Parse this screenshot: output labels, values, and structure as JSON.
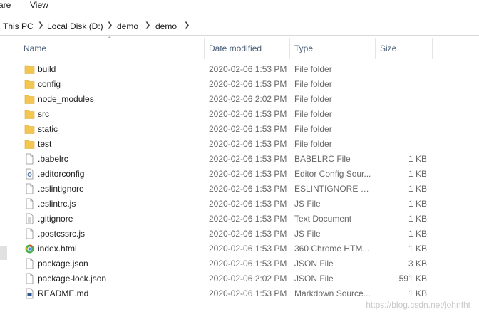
{
  "ribbon": {
    "share": "are",
    "view": "View"
  },
  "breadcrumb": [
    "This PC",
    "Local Disk (D:)",
    "demo",
    "demo"
  ],
  "columns": {
    "name": "Name",
    "date": "Date modified",
    "type": "Type",
    "size": "Size"
  },
  "files": [
    {
      "name": "build",
      "date": "2020-02-06 1:53 PM",
      "type": "File folder",
      "size": "",
      "icon": "folder-icon"
    },
    {
      "name": "config",
      "date": "2020-02-06 1:53 PM",
      "type": "File folder",
      "size": "",
      "icon": "folder-icon"
    },
    {
      "name": "node_modules",
      "date": "2020-02-06 2:02 PM",
      "type": "File folder",
      "size": "",
      "icon": "folder-icon"
    },
    {
      "name": "src",
      "date": "2020-02-06 1:53 PM",
      "type": "File folder",
      "size": "",
      "icon": "folder-icon"
    },
    {
      "name": "static",
      "date": "2020-02-06 1:53 PM",
      "type": "File folder",
      "size": "",
      "icon": "folder-icon"
    },
    {
      "name": "test",
      "date": "2020-02-06 1:53 PM",
      "type": "File folder",
      "size": "",
      "icon": "folder-icon"
    },
    {
      "name": ".babelrc",
      "date": "2020-02-06 1:53 PM",
      "type": "BABELRC File",
      "size": "1 KB",
      "icon": "file-icon"
    },
    {
      "name": ".editorconfig",
      "date": "2020-02-06 1:53 PM",
      "type": "Editor Config Sour...",
      "size": "1 KB",
      "icon": "settings-file-icon"
    },
    {
      "name": ".eslintignore",
      "date": "2020-02-06 1:53 PM",
      "type": "ESLINTIGNORE File",
      "size": "1 KB",
      "icon": "file-icon"
    },
    {
      "name": ".eslintrc.js",
      "date": "2020-02-06 1:53 PM",
      "type": "JS File",
      "size": "1 KB",
      "icon": "file-icon"
    },
    {
      "name": ".gitignore",
      "date": "2020-02-06 1:53 PM",
      "type": "Text Document",
      "size": "1 KB",
      "icon": "text-file-icon"
    },
    {
      "name": ".postcssrc.js",
      "date": "2020-02-06 1:53 PM",
      "type": "JS File",
      "size": "1 KB",
      "icon": "file-icon"
    },
    {
      "name": "index.html",
      "date": "2020-02-06 1:53 PM",
      "type": "360 Chrome HTM...",
      "size": "1 KB",
      "icon": "chrome-html-icon"
    },
    {
      "name": "package.json",
      "date": "2020-02-06 1:53 PM",
      "type": "JSON File",
      "size": "3 KB",
      "icon": "file-icon"
    },
    {
      "name": "package-lock.json",
      "date": "2020-02-06 2:02 PM",
      "type": "JSON File",
      "size": "591 KB",
      "icon": "file-icon"
    },
    {
      "name": "README.md",
      "date": "2020-02-06 1:53 PM",
      "type": "Markdown Source...",
      "size": "1 KB",
      "icon": "markdown-file-icon"
    }
  ],
  "watermark": "https://blog.csdn.net/johnfht",
  "colors": {
    "folder": "#f3c74f",
    "header_text": "#4c607a",
    "secondary_text": "#666666"
  }
}
